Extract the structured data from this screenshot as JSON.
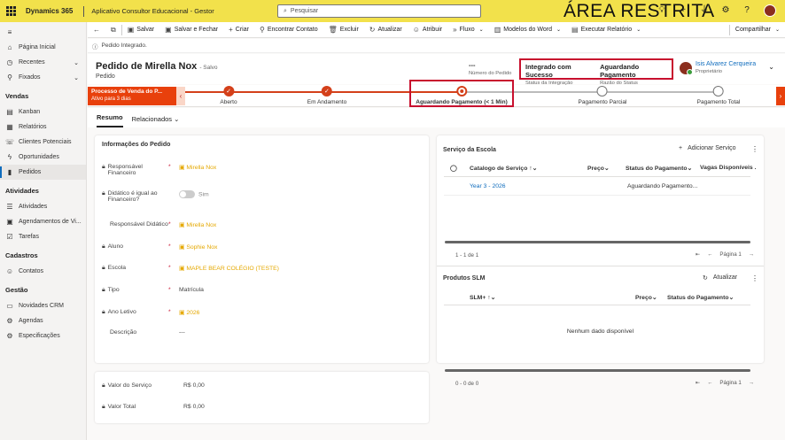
{
  "topbar": {
    "brand": "Dynamics 365",
    "app_name": "Aplicativo Consultor Educacional - Gestor",
    "search_placeholder": "Pesquisar",
    "overlay_text": "ÁREA RESTRITA"
  },
  "sidebar": {
    "top_items": [
      {
        "label": "Página Inicial",
        "icon": "home-icon"
      },
      {
        "label": "Recentes",
        "icon": "clock-icon"
      },
      {
        "label": "Fixados",
        "icon": "pin-icon"
      }
    ],
    "sections": [
      {
        "title": "Vendas",
        "items": [
          {
            "label": "Kanban"
          },
          {
            "label": "Relatórios"
          },
          {
            "label": "Clientes Potenciais"
          },
          {
            "label": "Oportunidades"
          },
          {
            "label": "Pedidos"
          }
        ]
      },
      {
        "title": "Atividades",
        "items": [
          {
            "label": "Atividades"
          },
          {
            "label": "Agendamentos de Vi..."
          },
          {
            "label": "Tarefas"
          }
        ]
      },
      {
        "title": "Cadastros",
        "items": [
          {
            "label": "Contatos"
          }
        ]
      },
      {
        "title": "Gestão",
        "items": [
          {
            "label": "Novidades CRM"
          },
          {
            "label": "Agendas"
          },
          {
            "label": "Especificações"
          }
        ]
      }
    ]
  },
  "commands": {
    "save": "Salvar",
    "save_close": "Salvar e Fechar",
    "new": "Criar",
    "find_contact": "Encontrar Contato",
    "delete": "Excluir",
    "refresh": "Atualizar",
    "assign": "Atribuir",
    "flow": "Fluxo",
    "word": "Modelos do Word",
    "report": "Executar Relatório",
    "share": "Compartilhar"
  },
  "notice": "Pedido Integrado.",
  "record": {
    "title": "Pedido de Mirella Nox",
    "saved": "- Salvo",
    "entity": "Pedido",
    "order_number": "---",
    "order_number_label": "Número do Pedido",
    "integration_status": "Integrado com Sucesso",
    "integration_label": "Status da Integração",
    "status_reason": "Aguardando Pagamento",
    "status_reason_label": "Razão do Status",
    "owner": "Isis Alvarez Cerqueira",
    "owner_label": "Proprietário"
  },
  "bpf": {
    "name": "Processo de Venda do P...",
    "active_for": "Ativo para 3 dias",
    "stages": [
      {
        "label": "Aberto",
        "state": "done"
      },
      {
        "label": "Em Andamento",
        "state": "done"
      },
      {
        "label": "Aguardando Pagamento  (< 1 Min)",
        "state": "current"
      },
      {
        "label": "Pagamento Parcial",
        "state": "todo"
      },
      {
        "label": "Pagamento Total",
        "state": "todo"
      }
    ]
  },
  "tabs": [
    "Resumo",
    "Relacionados"
  ],
  "info": {
    "title": "Informações do Pedido",
    "fields": [
      {
        "label": "Responsável Financeiro",
        "value": "Mirella Nox",
        "lock": true,
        "required": true,
        "link": true
      },
      {
        "label": "Didático é igual ao Financeiro?",
        "value": "Sim",
        "lock": true,
        "toggle": true
      },
      {
        "label": "Responsável Didático",
        "value": "Mirella Nox",
        "lock": false,
        "required": true,
        "link": true
      },
      {
        "label": "Aluno",
        "value": "Sophie Nox",
        "lock": true,
        "required": true,
        "link": true
      },
      {
        "label": "Escola",
        "value": "MAPLE BEAR COLÉGIO (TESTE)",
        "lock": true,
        "required": true,
        "link": true
      },
      {
        "label": "Tipo",
        "value": "Matrícula",
        "lock": true,
        "required": true
      },
      {
        "label": "Ano Letivo",
        "value": "2026",
        "lock": true,
        "required": true,
        "link": true
      },
      {
        "label": "Descrição",
        "value": "---",
        "lock": false
      }
    ]
  },
  "totals": [
    {
      "label": "Valor do Serviço",
      "value": "R$ 0,00"
    },
    {
      "label": "Valor Total",
      "value": "R$ 0,00"
    }
  ],
  "services": {
    "title": "Serviço da Escola",
    "add_label": "Adicionar Serviço",
    "columns": [
      "Catalogo de Serviço",
      "Preço",
      "Status do Pagamento",
      "Vagas Disponíveis ."
    ],
    "rows": [
      {
        "catalog": "Year 3 - 2026",
        "price": "",
        "status": "Aguardando Pagamento..."
      }
    ],
    "count": "1 - 1 de 1",
    "page": "Página 1"
  },
  "products": {
    "title": "Produtos SLM",
    "refresh_label": "Atualizar",
    "columns": [
      "SLM+",
      "Preço",
      "Status do Pagamento"
    ],
    "empty": "Nenhum dado disponível",
    "count": "0 - 0 de 0",
    "page": "Página 1"
  }
}
